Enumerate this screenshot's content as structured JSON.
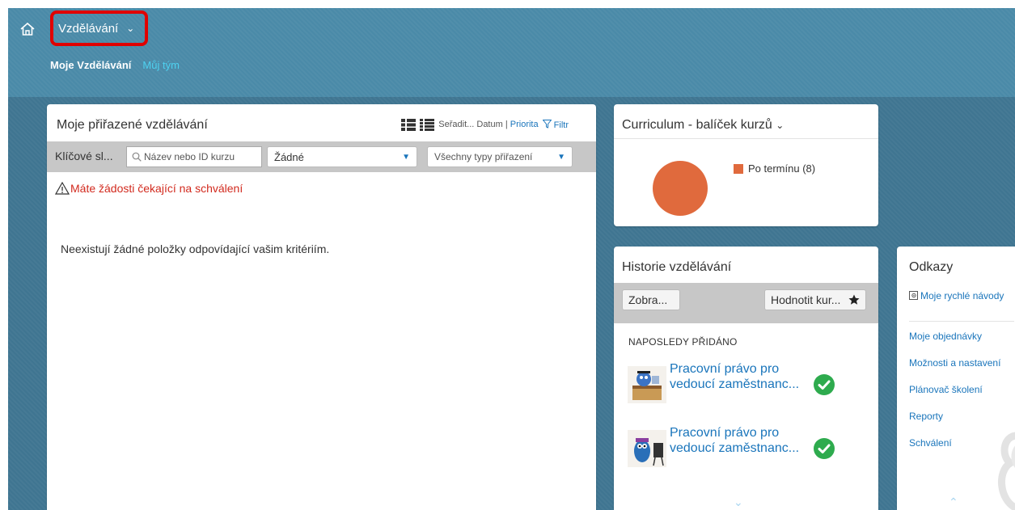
{
  "header": {
    "home_icon": "home-icon",
    "module_menu_label": "Vzdělávání",
    "module_menu_icon": "chevron-down-icon",
    "highlight_color": "#e00000",
    "tabs": [
      {
        "label": "Moje Vzdělávání",
        "active": true
      },
      {
        "label": "Můj tým",
        "active": false
      }
    ]
  },
  "assigned": {
    "title": "Moje přiřazené vzdělávání",
    "view_icons": [
      "list-view-icon",
      "compact-list-icon"
    ],
    "sort_label": "Seřadit...",
    "sort_date": "Datum",
    "sort_separator": "|",
    "sort_priority": "Priorita",
    "filter_label": "Filtr",
    "keyword_label": "Klíčové sl...",
    "search_placeholder": "Název nebo ID kurzu",
    "select_status": "Žádné",
    "select_assignment": "Všechny typy přiřazení",
    "warning_text": "Máte žádosti čekající na schválení",
    "empty_message": "Neexistují žádné položky odpovídající vašim kritériím."
  },
  "curriculum": {
    "title": "Curriculum - balíček kurzů",
    "chart_color": "#e06a3d"
  },
  "chart_data": {
    "type": "pie",
    "title": "",
    "categories": [
      "Po termínu"
    ],
    "values": [
      8
    ],
    "legend": [
      "Po termínu (8)"
    ],
    "legend_placement": "right"
  },
  "history": {
    "title": "Historie vzdělávání",
    "show_button": "Zobra...",
    "rate_button": "Hodnotit kur...",
    "rate_icon": "star-icon",
    "section_heading": "NAPOSLEDY PŘIDÁNO",
    "items": [
      {
        "line1": "Pracovní právo pro",
        "line2": "vedoucí zaměstnanc...",
        "icon": "completed-check-icon"
      },
      {
        "line1": "Pracovní právo pro",
        "line2": "vedoucí zaměstnanc...",
        "icon": "completed-check-icon"
      }
    ]
  },
  "links": {
    "title": "Odkazy",
    "items": [
      "Moje rychlé návody",
      "Moje objednávky",
      "Možnosti a nastavení",
      "Plánovač školení",
      "Reporty",
      "Schválení"
    ]
  }
}
